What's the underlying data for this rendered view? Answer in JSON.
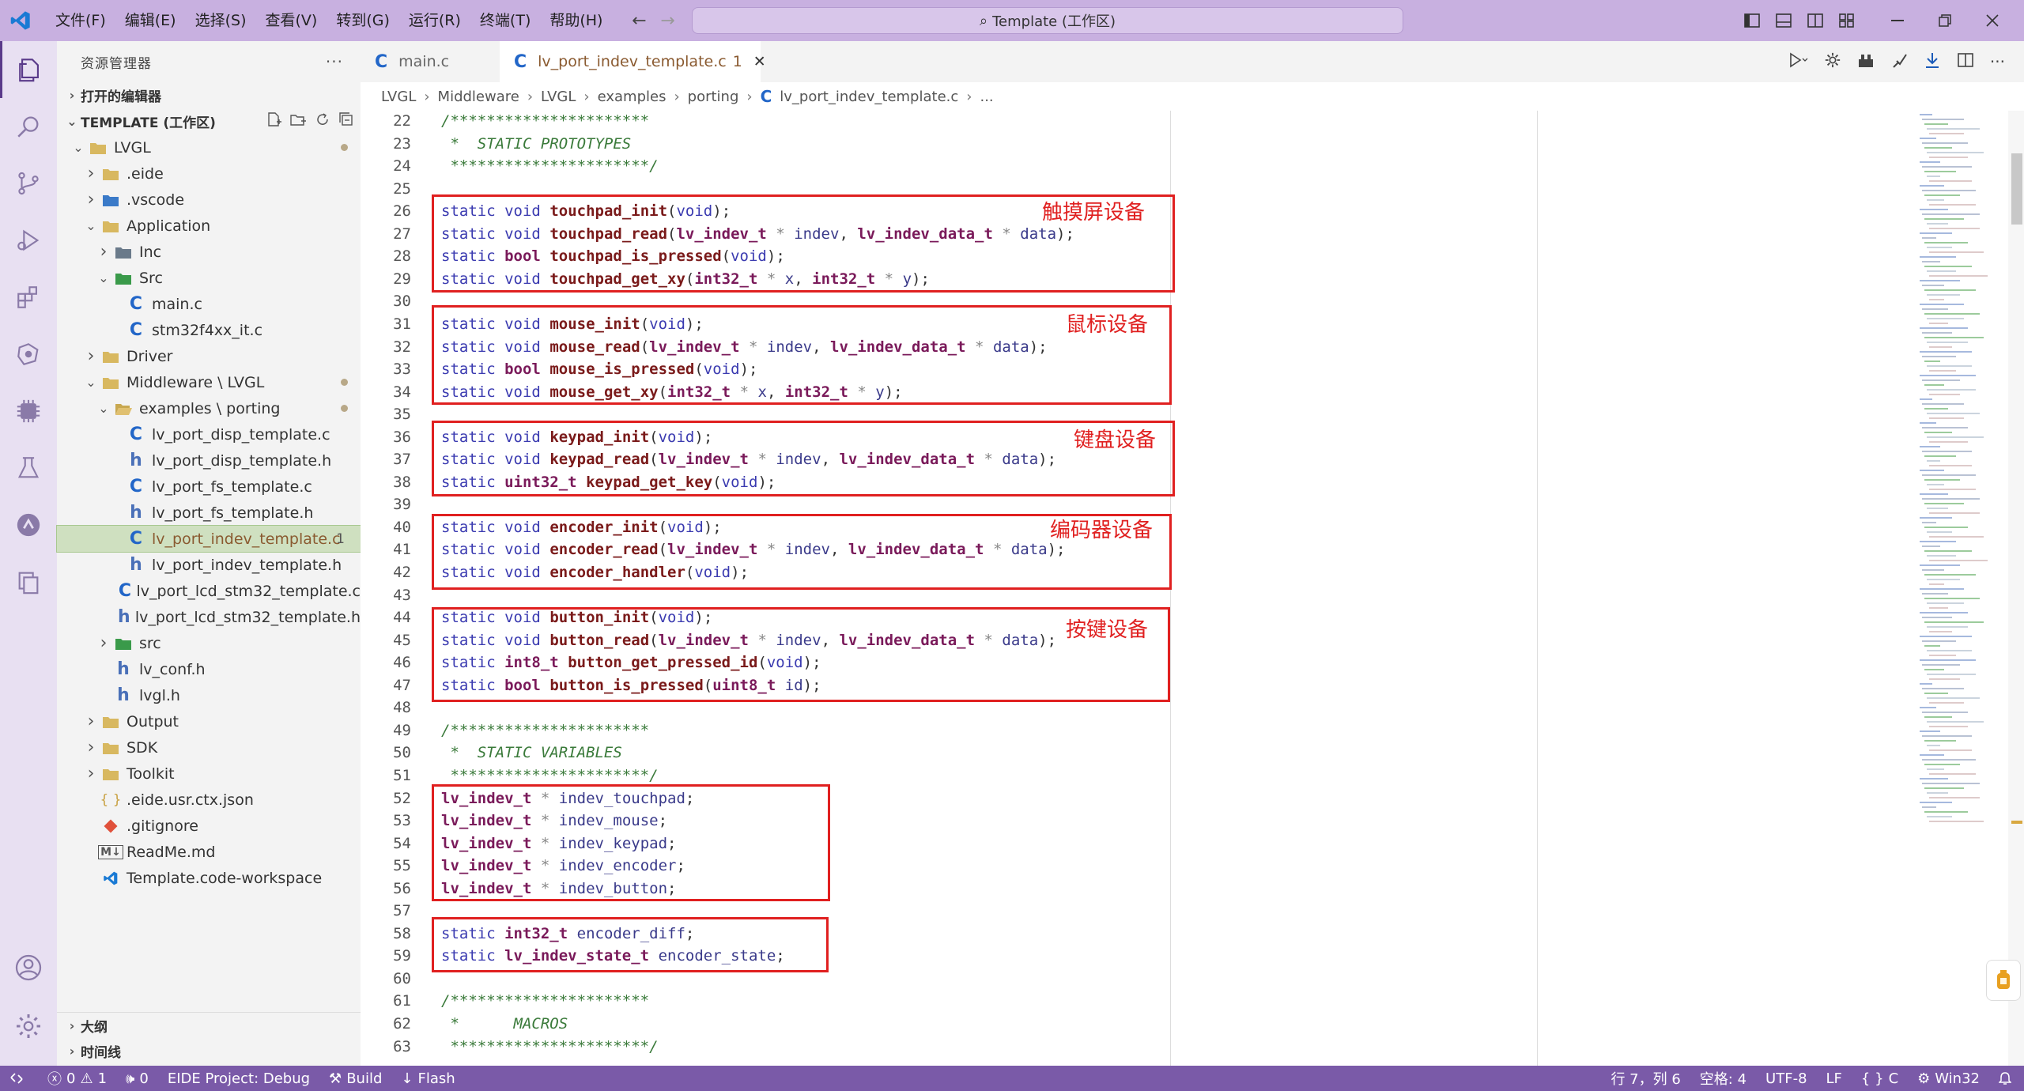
{
  "titlebar": {
    "menus": [
      "文件(F)",
      "编辑(E)",
      "选择(S)",
      "查看(V)",
      "转到(G)",
      "运行(R)",
      "终端(T)",
      "帮助(H)"
    ],
    "search_text": "Template (工作区)"
  },
  "sidebar": {
    "title": "资源管理器",
    "open_editors": "打开的编辑器",
    "workspace": "TEMPLATE (工作区)",
    "tree": [
      {
        "label": "LVGL",
        "depth": 0,
        "chev": "v",
        "icon": "folder",
        "dot": true
      },
      {
        "label": ".eide",
        "depth": 1,
        "chev": ">",
        "icon": "folder"
      },
      {
        "label": ".vscode",
        "depth": 1,
        "chev": ">",
        "icon": "folder-vscode"
      },
      {
        "label": "Application",
        "depth": 1,
        "chev": "v",
        "icon": "folder"
      },
      {
        "label": "Inc",
        "depth": 2,
        "chev": ">",
        "icon": "folder-inc"
      },
      {
        "label": "Src",
        "depth": 2,
        "chev": "v",
        "icon": "folder-src"
      },
      {
        "label": "main.c",
        "depth": 3,
        "icon": "c"
      },
      {
        "label": "stm32f4xx_it.c",
        "depth": 3,
        "icon": "c"
      },
      {
        "label": "Driver",
        "depth": 1,
        "chev": ">",
        "icon": "folder"
      },
      {
        "label": "Middleware \\ LVGL",
        "depth": 1,
        "chev": "v",
        "icon": "folder",
        "dot": true
      },
      {
        "label": "examples \\ porting",
        "depth": 2,
        "chev": "v",
        "icon": "folder-open",
        "dot": true
      },
      {
        "label": "lv_port_disp_template.c",
        "depth": 3,
        "icon": "c"
      },
      {
        "label": "lv_port_disp_template.h",
        "depth": 3,
        "icon": "h"
      },
      {
        "label": "lv_port_fs_template.c",
        "depth": 3,
        "icon": "c"
      },
      {
        "label": "lv_port_fs_template.h",
        "depth": 3,
        "icon": "h"
      },
      {
        "label": "lv_port_indev_template.c",
        "depth": 3,
        "icon": "c",
        "selected": true,
        "badge": "1"
      },
      {
        "label": "lv_port_indev_template.h",
        "depth": 3,
        "icon": "h"
      },
      {
        "label": "lv_port_lcd_stm32_template.c",
        "depth": 3,
        "icon": "c"
      },
      {
        "label": "lv_port_lcd_stm32_template.h",
        "depth": 3,
        "icon": "h"
      },
      {
        "label": "src",
        "depth": 2,
        "chev": ">",
        "icon": "folder-src"
      },
      {
        "label": "lv_conf.h",
        "depth": 2,
        "icon": "h"
      },
      {
        "label": "lvgl.h",
        "depth": 2,
        "icon": "h"
      },
      {
        "label": "Output",
        "depth": 1,
        "chev": ">",
        "icon": "folder"
      },
      {
        "label": "SDK",
        "depth": 1,
        "chev": ">",
        "icon": "folder"
      },
      {
        "label": "Toolkit",
        "depth": 1,
        "chev": ">",
        "icon": "folder"
      },
      {
        "label": ".eide.usr.ctx.json",
        "depth": 1,
        "icon": "json"
      },
      {
        "label": ".gitignore",
        "depth": 1,
        "icon": "git"
      },
      {
        "label": "ReadMe.md",
        "depth": 1,
        "icon": "md"
      },
      {
        "label": "Template.code-workspace",
        "depth": 1,
        "icon": "vscode"
      }
    ],
    "outline": "大纲",
    "timeline": "时间线"
  },
  "tabs": [
    {
      "label": "main.c",
      "active": false
    },
    {
      "label": "lv_port_indev_template.c",
      "badge": "1",
      "active": true
    }
  ],
  "breadcrumb": [
    "LVGL",
    "Middleware",
    "LVGL",
    "examples",
    "porting",
    "lv_port_indev_template.c",
    "..."
  ],
  "code_lines": [
    {
      "n": "22",
      "t": "/**********************",
      "c": "cm"
    },
    {
      "n": "23",
      "t": " *  STATIC PROTOTYPES",
      "c": "cm"
    },
    {
      "n": "24",
      "t": " **********************/",
      "c": "cm"
    },
    {
      "n": "25",
      "t": ""
    },
    {
      "n": "26",
      "t": "static void touchpad_init(void);"
    },
    {
      "n": "27",
      "t": "static void touchpad_read(lv_indev_t * indev, lv_indev_data_t * data);"
    },
    {
      "n": "28",
      "t": "static bool touchpad_is_pressed(void);"
    },
    {
      "n": "29",
      "t": "static void touchpad_get_xy(int32_t * x, int32_t * y);"
    },
    {
      "n": "30",
      "t": ""
    },
    {
      "n": "31",
      "t": "static void mouse_init(void);"
    },
    {
      "n": "32",
      "t": "static void mouse_read(lv_indev_t * indev, lv_indev_data_t * data);"
    },
    {
      "n": "33",
      "t": "static bool mouse_is_pressed(void);"
    },
    {
      "n": "34",
      "t": "static void mouse_get_xy(int32_t * x, int32_t * y);"
    },
    {
      "n": "35",
      "t": ""
    },
    {
      "n": "36",
      "t": "static void keypad_init(void);"
    },
    {
      "n": "37",
      "t": "static void keypad_read(lv_indev_t * indev, lv_indev_data_t * data);"
    },
    {
      "n": "38",
      "t": "static uint32_t keypad_get_key(void);"
    },
    {
      "n": "39",
      "t": ""
    },
    {
      "n": "40",
      "t": "static void encoder_init(void);"
    },
    {
      "n": "41",
      "t": "static void encoder_read(lv_indev_t * indev, lv_indev_data_t * data);"
    },
    {
      "n": "42",
      "t": "static void encoder_handler(void);"
    },
    {
      "n": "43",
      "t": ""
    },
    {
      "n": "44",
      "t": "static void button_init(void);"
    },
    {
      "n": "45",
      "t": "static void button_read(lv_indev_t * indev, lv_indev_data_t * data);"
    },
    {
      "n": "46",
      "t": "static int8_t button_get_pressed_id(void);"
    },
    {
      "n": "47",
      "t": "static bool button_is_pressed(uint8_t id);"
    },
    {
      "n": "48",
      "t": ""
    },
    {
      "n": "49",
      "t": "/**********************",
      "c": "cm"
    },
    {
      "n": "50",
      "t": " *  STATIC VARIABLES",
      "c": "cm"
    },
    {
      "n": "51",
      "t": " **********************/",
      "c": "cm"
    },
    {
      "n": "52",
      "t": "lv_indev_t * indev_touchpad;"
    },
    {
      "n": "53",
      "t": "lv_indev_t * indev_mouse;"
    },
    {
      "n": "54",
      "t": "lv_indev_t * indev_keypad;"
    },
    {
      "n": "55",
      "t": "lv_indev_t * indev_encoder;"
    },
    {
      "n": "56",
      "t": "lv_indev_t * indev_button;"
    },
    {
      "n": "57",
      "t": ""
    },
    {
      "n": "58",
      "t": "static int32_t encoder_diff;"
    },
    {
      "n": "59",
      "t": "static lv_indev_state_t encoder_state;"
    },
    {
      "n": "60",
      "t": ""
    },
    {
      "n": "61",
      "t": "/**********************",
      "c": "cm"
    },
    {
      "n": "62",
      "t": " *      MACROS",
      "c": "cm"
    },
    {
      "n": "63",
      "t": " **********************/",
      "c": "cm"
    }
  ],
  "annotations": [
    "触摸屏设备",
    "鼠标设备",
    "键盘设备",
    "编码器设备",
    "按键设备"
  ],
  "statusbar": {
    "errors": "0",
    "warnings": "1",
    "ports": "0",
    "project": "EIDE Project: Debug",
    "build": "Build",
    "flash": "Flash",
    "position": "行 7，列 6",
    "spaces": "空格: 4",
    "encoding": "UTF-8",
    "eol": "LF",
    "language": "C",
    "platform": "Win32"
  },
  "colors": {
    "accent": "#7a5aa8",
    "titlebar": "#c8b0e0",
    "annotation": "#e02020"
  }
}
